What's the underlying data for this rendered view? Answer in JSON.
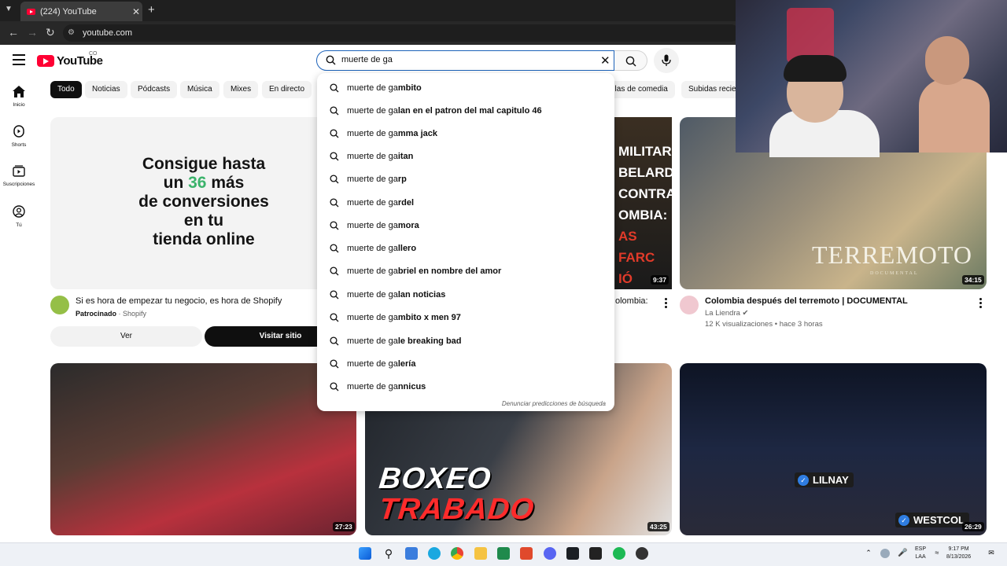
{
  "browser": {
    "tab_title": "(224) YouTube",
    "url": "youtube.com"
  },
  "header": {
    "logo_text": "YouTube",
    "country_code": "CO",
    "search_value": "muerte de ga"
  },
  "sidebar": {
    "items": [
      {
        "label": "Inicio",
        "icon": "home-icon"
      },
      {
        "label": "Shorts",
        "icon": "shorts-icon"
      },
      {
        "label": "Suscripciones",
        "icon": "subscriptions-icon"
      },
      {
        "label": "Tú",
        "icon": "you-icon"
      }
    ]
  },
  "chips": [
    "Todo",
    "Noticias",
    "Pódcasts",
    "Música",
    "Mixes",
    "En directo",
    "ulas de comedia",
    "Subidas recien"
  ],
  "suggestions": {
    "typed_prefix": "muerte de ga",
    "items": [
      {
        "prefix": "muerte de ga",
        "rest": "mbito"
      },
      {
        "prefix": "muerte de ga",
        "rest": "lan en el patron del mal capitulo 46"
      },
      {
        "prefix": "muerte de ga",
        "rest": "mma jack"
      },
      {
        "prefix": "muerte de ga",
        "rest": "itan"
      },
      {
        "prefix": "muerte de ga",
        "rest": "rp"
      },
      {
        "prefix": "muerte de ga",
        "rest": "rdel"
      },
      {
        "prefix": "muerte de ga",
        "rest": "mora"
      },
      {
        "prefix": "muerte de ga",
        "rest": "llero"
      },
      {
        "prefix": "muerte de ga",
        "rest": "briel en nombre del amor"
      },
      {
        "prefix": "muerte de ga",
        "rest": "lan noticias"
      },
      {
        "prefix": "muerte de ga",
        "rest": "mbito x men 97"
      },
      {
        "prefix": "muerte de ga",
        "rest": "le breaking bad"
      },
      {
        "prefix": "muerte de ga",
        "rest": "lería"
      },
      {
        "prefix": "muerte de ga",
        "rest": "nnicus"
      }
    ],
    "report_link": "Denunciar predicciones de búsqueda"
  },
  "ad": {
    "headline_1": "Consigue hasta",
    "headline_2a": "un",
    "headline_2b": "36",
    "headline_2c": "más",
    "headline_3": "de conversiones",
    "headline_4": "en tu",
    "headline_5": "tienda online",
    "title": "Si es hora de empezar tu negocio, es hora de Shopify",
    "sponsored": "Patrocinado",
    "sponsor": "Shopify",
    "ver_label": "Ver",
    "visit_label": "Visitar sitio"
  },
  "videos": [
    {
      "overlay_1": "MILITAR",
      "overlay_2": "BELARDO",
      "overlay_3": "CONTRA",
      "overlay_4": "OMBIA:",
      "overlay_5": "AS FARC",
      "overlay_6": "IÓ",
      "title": "olombia:",
      "duration": "9:37"
    },
    {
      "overlay_title": "TERREMOTO",
      "overlay_sub": "DOCUMENTAL",
      "title": "Colombia después del terremoto | DOCUMENTAL",
      "channel": "La Liendra",
      "views": "12 K visualizaciones",
      "age": "hace 3 horas",
      "duration": "34:15"
    },
    {
      "duration": "27:23"
    },
    {
      "overlay_1": "BOXEO",
      "overlay_2": "TRABADO",
      "duration": "43:25"
    },
    {
      "tag_1": "LILNAY",
      "tag_2": "WESTCOL",
      "duration": "26:29"
    }
  ],
  "tray": {
    "lang_1": "ESP",
    "lang_2": "LAA",
    "time": "9:17 PM",
    "date": "8/13/2026"
  }
}
